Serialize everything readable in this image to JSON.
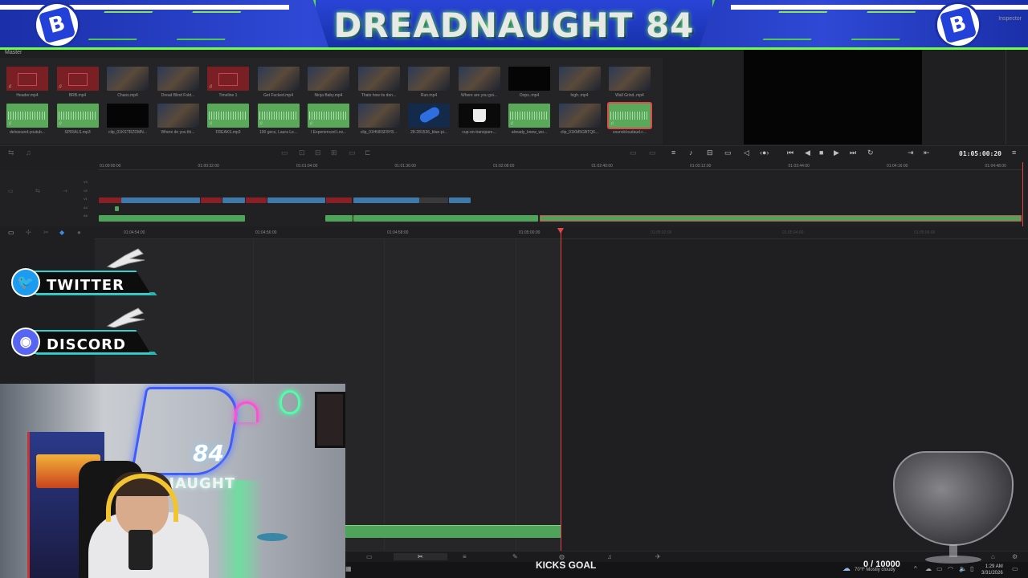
{
  "banner": {
    "title": "DREADNAUGHT 84",
    "logo_letter": "B",
    "inspector_label": "Inspector"
  },
  "media_pool": {
    "section_label": "Master",
    "row1": [
      {
        "name": "Header.mp4",
        "kind": "red"
      },
      {
        "name": "BRB.mp4",
        "kind": "red"
      },
      {
        "name": "Chaos.mp4",
        "kind": "video"
      },
      {
        "name": "Dread Blind Fold...",
        "kind": "video"
      },
      {
        "name": "Timeline 1",
        "kind": "red"
      },
      {
        "name": "Get Fucked.mp4",
        "kind": "video"
      },
      {
        "name": "Ninja Baby.mp4",
        "kind": "video"
      },
      {
        "name": "Thats how its don...",
        "kind": "video"
      },
      {
        "name": "Run.mp4",
        "kind": "video"
      },
      {
        "name": "Where are you goi...",
        "kind": "video"
      },
      {
        "name": "Oops..mp4",
        "kind": "black"
      },
      {
        "name": "high..mp4",
        "kind": "video"
      },
      {
        "name": "Wall Grind..mp4",
        "kind": "video"
      }
    ],
    "row2": [
      {
        "name": "delosound-youtub...",
        "kind": "audio"
      },
      {
        "name": "SPIRALS.mp3",
        "kind": "audio"
      },
      {
        "name": "clip_01KSTRZDMN...",
        "kind": "black"
      },
      {
        "name": "Where do you thi...",
        "kind": "video"
      },
      {
        "name": "FREAKS.mp3",
        "kind": "audio"
      },
      {
        "name": "100 gecs, Laura Le...",
        "kind": "audio"
      },
      {
        "name": "I Experienced Lov...",
        "kind": "audio"
      },
      {
        "name": "clip_01HN6SF8Y8...",
        "kind": "video"
      },
      {
        "name": "28-281536_blue-pi...",
        "kind": "blue"
      },
      {
        "name": "cup-on-transpare...",
        "kind": "white"
      },
      {
        "name": "already_knew_wo...",
        "kind": "audio"
      },
      {
        "name": "clip_01KM5GBTQ6...",
        "kind": "video"
      },
      {
        "name": "soundcloudaud.c...",
        "kind": "audio"
      }
    ]
  },
  "transport": {
    "timecode": "01:05:00:20"
  },
  "upper_ruler": [
    "01:00:00:00",
    "01:00:32:00",
    "01:01:04:00",
    "01:01:36:00",
    "01:02:08:00",
    "01:02:40:00",
    "01:03:12:00",
    "01:03:44:00",
    "01:04:16:00",
    "01:04:48:00"
  ],
  "upper_tracks": [
    "V3",
    "V2",
    "V1",
    "A4",
    "A5"
  ],
  "lower_ruler": [
    "01:04:54:00",
    "01:04:56:00",
    "01:04:58:00",
    "01:05:00:00",
    "01:05:02:00",
    "01:05:04:00",
    "01:05:06:00"
  ],
  "social": {
    "twitter": "TWITTER",
    "discord": "DISCORD"
  },
  "webcam": {
    "neon_text": "84",
    "sign_text": "DNAUGHT",
    "arcade_text": "MARVEL CAPCOM"
  },
  "overlay": {
    "kicks": "KICKS GOAL",
    "goal": "0 / 10000",
    "weather": "70°F  Mostly cloudy",
    "clock_time": "1:29 AM",
    "clock_date": "3/31/2026"
  },
  "colors": {
    "accent_green": "#4fa35a",
    "clip_red": "#8a1f26",
    "clip_blue": "#3f79aa",
    "playhead": "#e04848",
    "banner_blue": "#1a2fa8",
    "neon_green": "#6fff4a"
  }
}
